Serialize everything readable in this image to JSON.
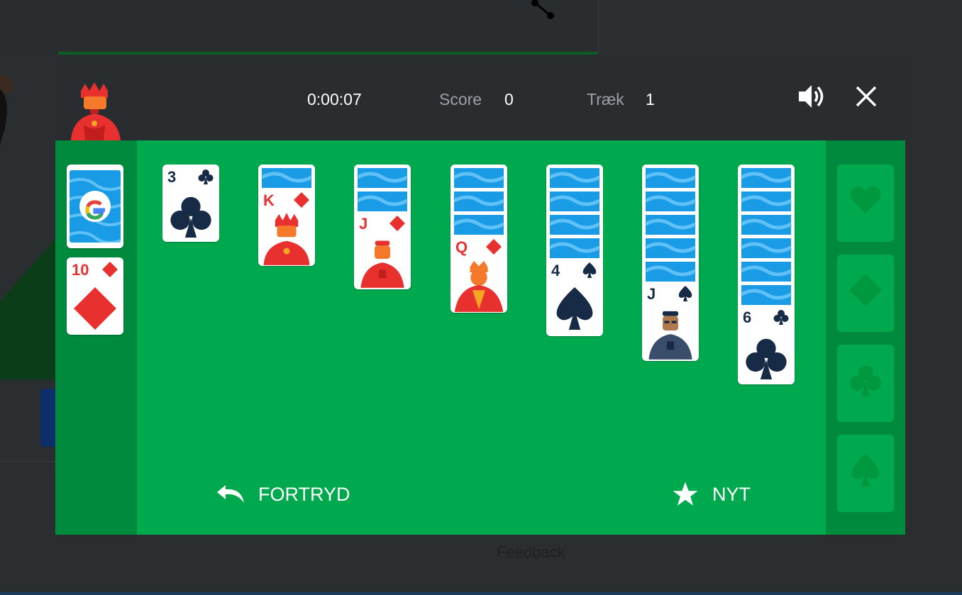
{
  "header": {
    "timer": "0:00:07",
    "score_label": "Score",
    "score_value": "0",
    "moves_label": "Træk",
    "moves_value": "1"
  },
  "stock": {
    "logo": "G"
  },
  "waste": {
    "rank": "10",
    "suit": "diamond"
  },
  "tableau": [
    {
      "face_down": 0,
      "rank": "3",
      "suit": "club"
    },
    {
      "face_down": 1,
      "rank": "K",
      "suit": "diamond"
    },
    {
      "face_down": 2,
      "rank": "J",
      "suit": "diamond"
    },
    {
      "face_down": 3,
      "rank": "Q",
      "suit": "diamond"
    },
    {
      "face_down": 4,
      "rank": "4",
      "suit": "spade"
    },
    {
      "face_down": 5,
      "rank": "J",
      "suit": "spade"
    },
    {
      "face_down": 6,
      "rank": "6",
      "suit": "club"
    }
  ],
  "foundations": [
    "heart",
    "diamond",
    "club",
    "spade"
  ],
  "buttons": {
    "undo": "FORTRYD",
    "new_game": "NYT"
  },
  "footer": {
    "feedback": "Feedback"
  },
  "colors": {
    "felt": "#01a94e",
    "felt_dark": "#008a3e",
    "red_suit": "#e8312f",
    "black_suit": "#172b47",
    "card_back": "#1a9be6"
  }
}
